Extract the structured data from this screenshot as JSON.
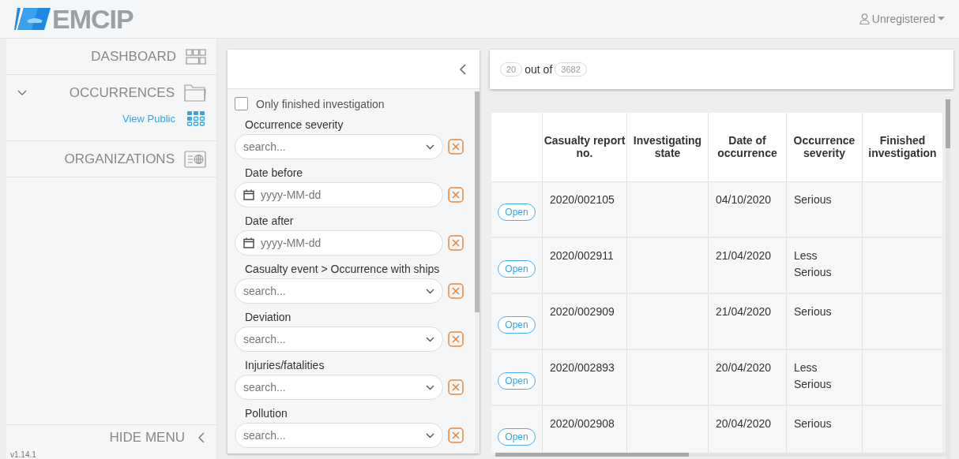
{
  "header": {
    "logo": "EMCIP",
    "user_menu": "Unregistered"
  },
  "sidebar": {
    "items": [
      {
        "label": "DASHBOARD",
        "expanded": false
      },
      {
        "label": "OCCURRENCES",
        "expanded": true,
        "children": [
          {
            "label": "View Public"
          }
        ]
      },
      {
        "label": "ORGANIZATIONS",
        "expanded": false
      }
    ],
    "hide_menu": "HIDE MENU",
    "version": "v1.14.1"
  },
  "filters": {
    "checkbox": {
      "label": "Only finished investigation",
      "checked": false
    },
    "fields": [
      {
        "label": "Occurrence severity",
        "kind": "select",
        "placeholder": "search..."
      },
      {
        "label": "Date before",
        "kind": "date",
        "placeholder": "yyyy-MM-dd"
      },
      {
        "label": "Date after",
        "kind": "date",
        "placeholder": "yyyy-MM-dd"
      },
      {
        "label": "Casualty event > Occurrence with ships",
        "kind": "select",
        "placeholder": "search..."
      },
      {
        "label": "Deviation",
        "kind": "select",
        "placeholder": "search..."
      },
      {
        "label": "Injuries/fatalities",
        "kind": "select",
        "placeholder": "search..."
      },
      {
        "label": "Pollution",
        "kind": "select",
        "placeholder": "search..."
      }
    ]
  },
  "results": {
    "shown": "20",
    "connector": "out of",
    "total": "3682"
  },
  "table": {
    "columns": [
      "Casualty report no.",
      "Investigating state",
      "Date of occurrence",
      "Occurrence severity",
      "Finished investigation"
    ],
    "rows": [
      {
        "action": "Open",
        "cells": [
          "2020/002105",
          "",
          "04/10/2020",
          "Serious",
          ""
        ]
      },
      {
        "action": "Open",
        "cells": [
          "2020/002911",
          "",
          "21/04/2020",
          "Less Serious",
          ""
        ]
      },
      {
        "action": "Open",
        "cells": [
          "2020/002909",
          "",
          "21/04/2020",
          "Serious",
          ""
        ]
      },
      {
        "action": "Open",
        "cells": [
          "2020/002893",
          "",
          "20/04/2020",
          "Less Serious",
          ""
        ]
      },
      {
        "action": "Open",
        "cells": [
          "2020/002908",
          "",
          "20/04/2020",
          "Serious",
          ""
        ]
      }
    ]
  }
}
